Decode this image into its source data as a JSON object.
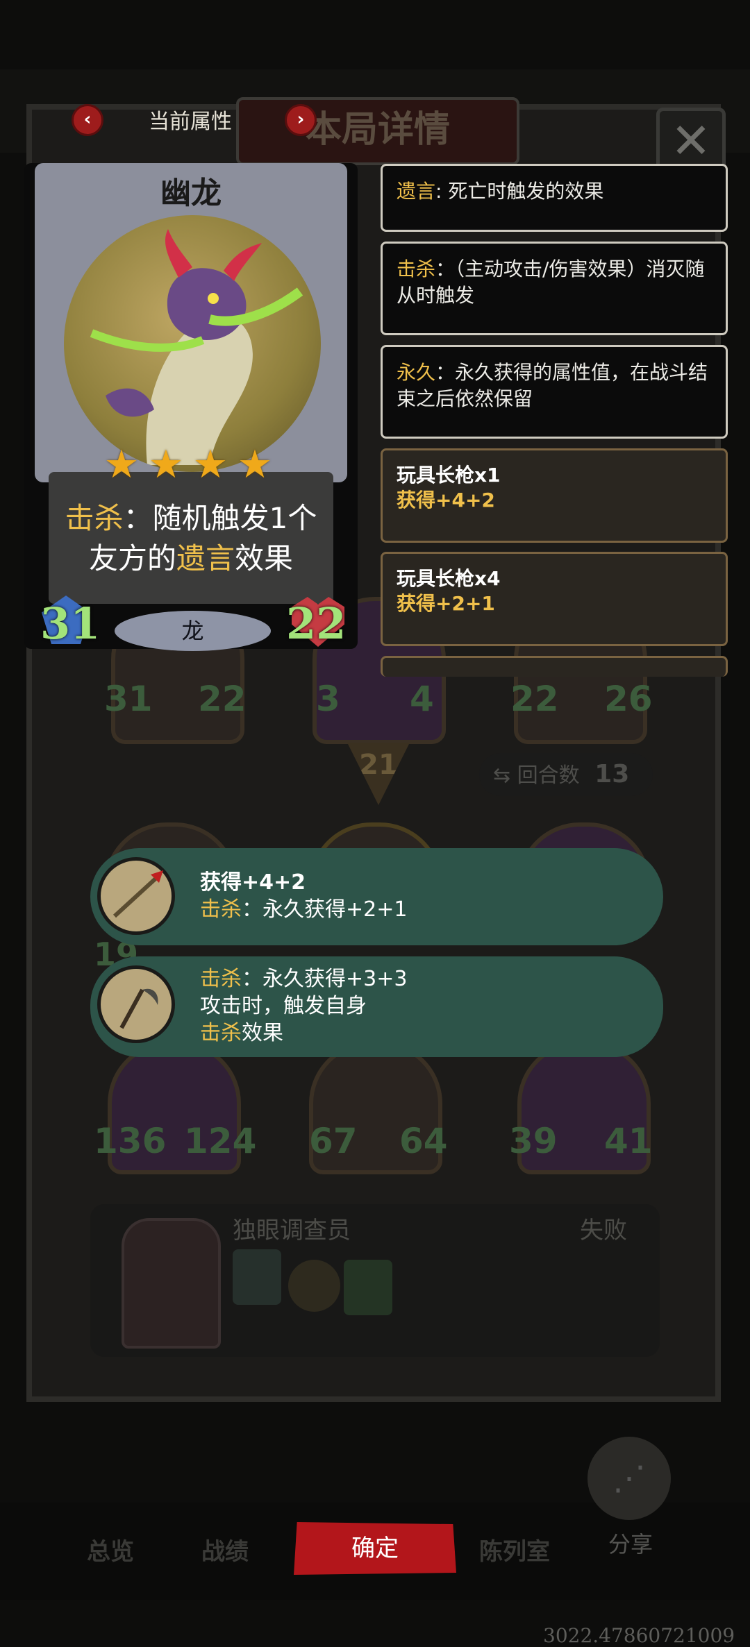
{
  "header": {
    "current_attr_label": "当前属性",
    "title": "本局详情",
    "close_glyph": "✕",
    "prev_glyph": "‹",
    "next_glyph": "›"
  },
  "card": {
    "name": "幽龙",
    "stars": 4,
    "desc_kw1": "击杀",
    "desc_part1": "：随机触发1个",
    "desc_part2": "友方的",
    "desc_kw2": "遗言",
    "desc_part3": "效果",
    "attack": "31",
    "health": "22",
    "tribe": "龙"
  },
  "keywords": [
    {
      "kw": "遗言",
      "text": ": 死亡时触发的效果"
    },
    {
      "kw": "击杀",
      "text": "：（主动攻击/伤害效果）消灭随从时触发"
    },
    {
      "kw": "永久",
      "text": "：永久获得的属性值，在战斗结束之后依然保留"
    }
  ],
  "items": [
    {
      "name": "玩具长枪x1",
      "gain": "获得+4+2"
    },
    {
      "name": "玩具长枪x4",
      "gain": "获得+2+1"
    }
  ],
  "relics": [
    {
      "line1": "获得+4+2",
      "kw": "击杀",
      "line2": "：永久获得+2+1"
    },
    {
      "kw": "击杀",
      "line1": "：永久获得+3+3",
      "line2": "攻击时，触发自身",
      "kw2": "击杀",
      "line3": "效果"
    }
  ],
  "background": {
    "top_stats": [
      {
        "atk": "31",
        "hp": "22"
      },
      {
        "atk": "3",
        "hp": "4"
      },
      {
        "atk": "22",
        "hp": "26"
      }
    ],
    "turn_arrow_value": "21",
    "round_label": "回合数",
    "round_value": "13",
    "mid_stat_fragment": "19",
    "bottom_stats": [
      {
        "atk": "136",
        "hp": "124"
      },
      {
        "atk": "67",
        "hp": "64"
      },
      {
        "atk": "39",
        "hp": "41"
      }
    ],
    "opponent_name": "独眼调查员",
    "result": "失败"
  },
  "footer": {
    "tabs": [
      "总览",
      "战绩",
      "陈列室"
    ],
    "confirm": "确定",
    "share": "分享",
    "share_glyph": "⋰"
  },
  "overlay_text": "3022.47860721009"
}
